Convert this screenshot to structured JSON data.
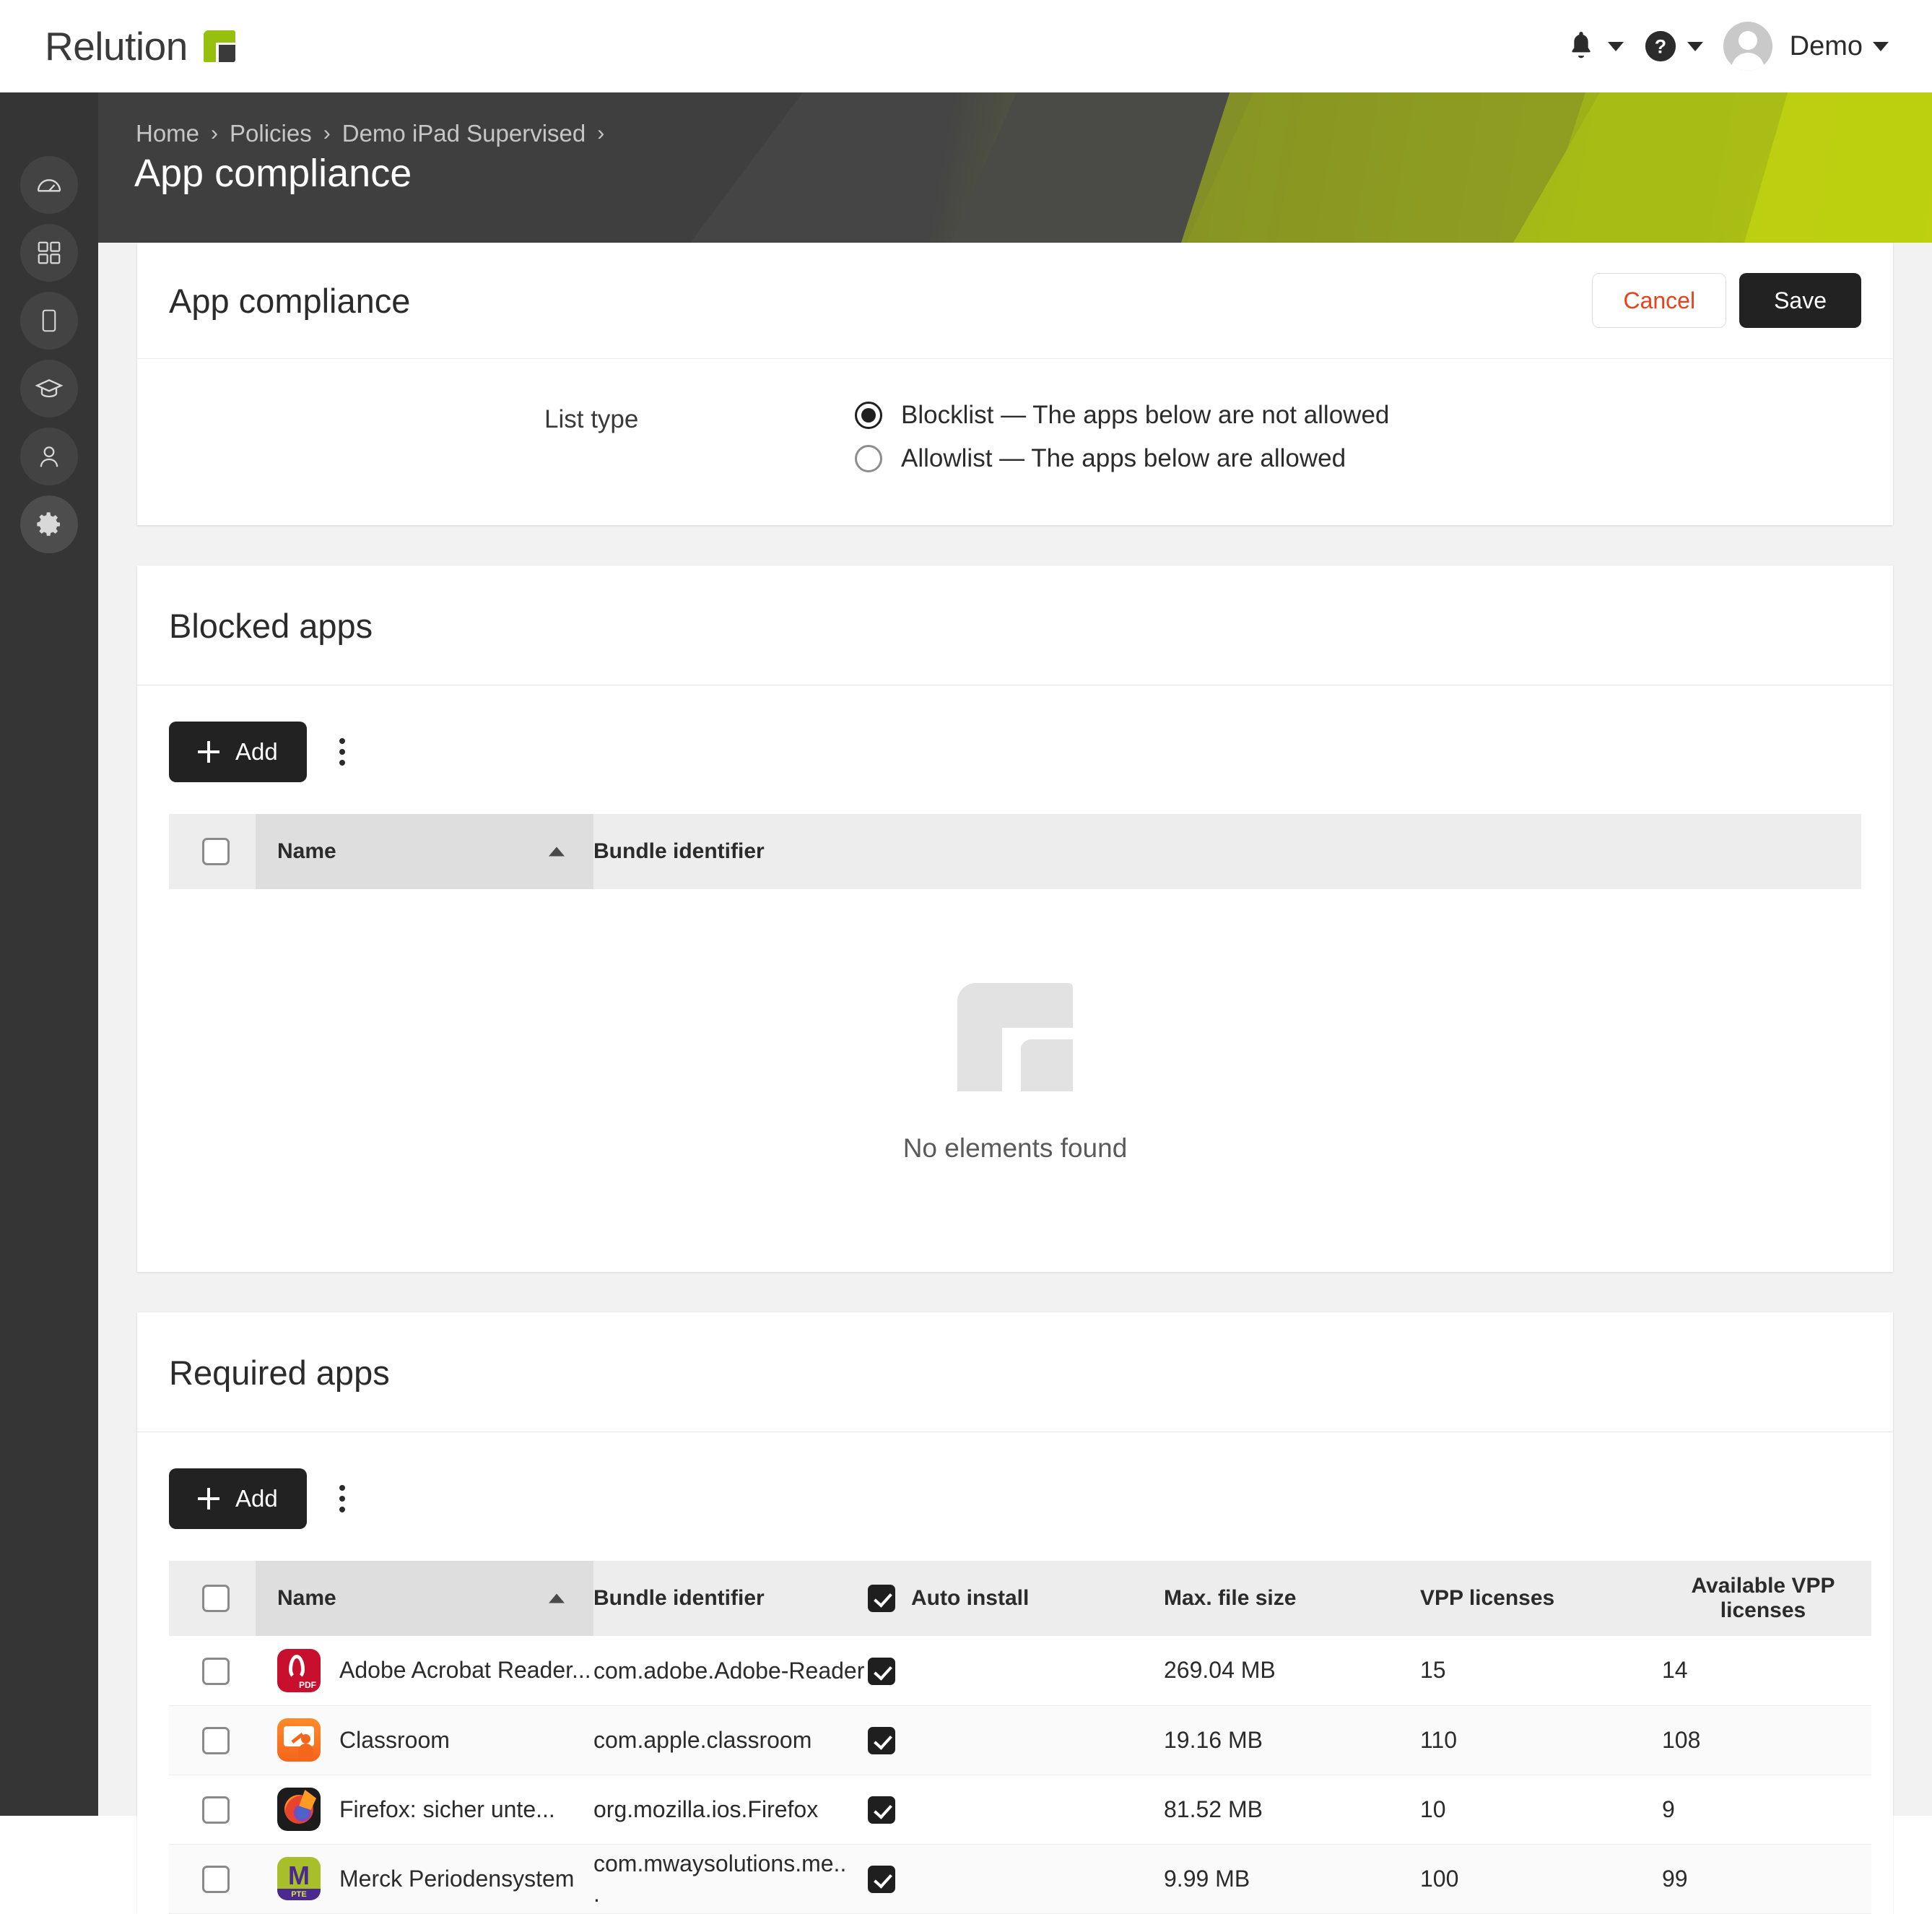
{
  "brand": {
    "name": "Relution",
    "logo_icon": "relution-logo-icon",
    "accent": "#97bf0d"
  },
  "topbar": {
    "notifications_icon": "bell-icon",
    "help_icon": "question-circle-icon",
    "avatar_icon": "user-avatar-icon",
    "user_name": "Demo",
    "chevron_icon": "chevron-down-icon"
  },
  "sidebar": {
    "items": [
      {
        "icon": "dashboard-gauge-icon",
        "active": false
      },
      {
        "icon": "apps-grid-icon",
        "active": false
      },
      {
        "icon": "device-tablet-icon",
        "active": false
      },
      {
        "icon": "graduation-cap-icon",
        "active": false
      },
      {
        "icon": "user-icon",
        "active": false
      },
      {
        "icon": "gear-icon",
        "active": true
      }
    ]
  },
  "breadcrumb": {
    "items": [
      "Home",
      "Policies",
      "Demo iPad Supervised"
    ],
    "separator": "›",
    "trailing_separator": "›"
  },
  "page": {
    "title": "App compliance"
  },
  "compliance_card": {
    "title": "App compliance",
    "cancel_label": "Cancel",
    "save_label": "Save",
    "cancel_color": "#e8411c",
    "list_type_label": "List type",
    "options": [
      {
        "label": "Blocklist — The apps below are not allowed",
        "selected": true
      },
      {
        "label": "Allowlist — The apps below are allowed",
        "selected": false
      }
    ]
  },
  "blocked_apps": {
    "title": "Blocked apps",
    "add_label": "Add",
    "add_icon": "plus-icon",
    "menu_icon": "kebab-menu-icon",
    "columns": [
      "Name",
      "Bundle identifier"
    ],
    "sort_column": "Name",
    "sort_direction": "asc",
    "rows": [],
    "empty_text": "No elements found",
    "empty_icon": "relution-placeholder-icon"
  },
  "required_apps": {
    "title": "Required apps",
    "add_label": "Add",
    "add_icon": "plus-icon",
    "menu_icon": "kebab-menu-icon",
    "columns": {
      "name": "Name",
      "bundle": "Bundle identifier",
      "auto_install": "Auto install",
      "max_file_size": "Max. file size",
      "vpp_licenses": "VPP licenses",
      "available_vpp": "Available VPP licenses"
    },
    "sort_column": "Name",
    "sort_direction": "asc",
    "auto_install_header_checked": true,
    "rows": [
      {
        "name": "Adobe Acrobat Reader...",
        "icon": "adobe-acrobat-reader-icon",
        "bundle": "com.adobe.Adobe-Reader",
        "auto_install": true,
        "max_file_size": "269.04 MB",
        "vpp_licenses": "15",
        "available_vpp": "14",
        "selected": false
      },
      {
        "name": "Classroom",
        "icon": "apple-classroom-icon",
        "bundle": "com.apple.classroom",
        "auto_install": true,
        "max_file_size": "19.16 MB",
        "vpp_licenses": "110",
        "available_vpp": "108",
        "selected": false
      },
      {
        "name": "Firefox: sicher unte...",
        "icon": "firefox-icon",
        "bundle": "org.mozilla.ios.Firefox",
        "auto_install": true,
        "max_file_size": "81.52 MB",
        "vpp_licenses": "10",
        "available_vpp": "9",
        "selected": false
      },
      {
        "name": "Merck Periodensystem",
        "icon": "merck-pte-icon",
        "bundle": "com.mwaysolutions.me..\n.",
        "auto_install": true,
        "max_file_size": "9.99 MB",
        "vpp_licenses": "100",
        "available_vpp": "99",
        "selected": false
      }
    ]
  }
}
